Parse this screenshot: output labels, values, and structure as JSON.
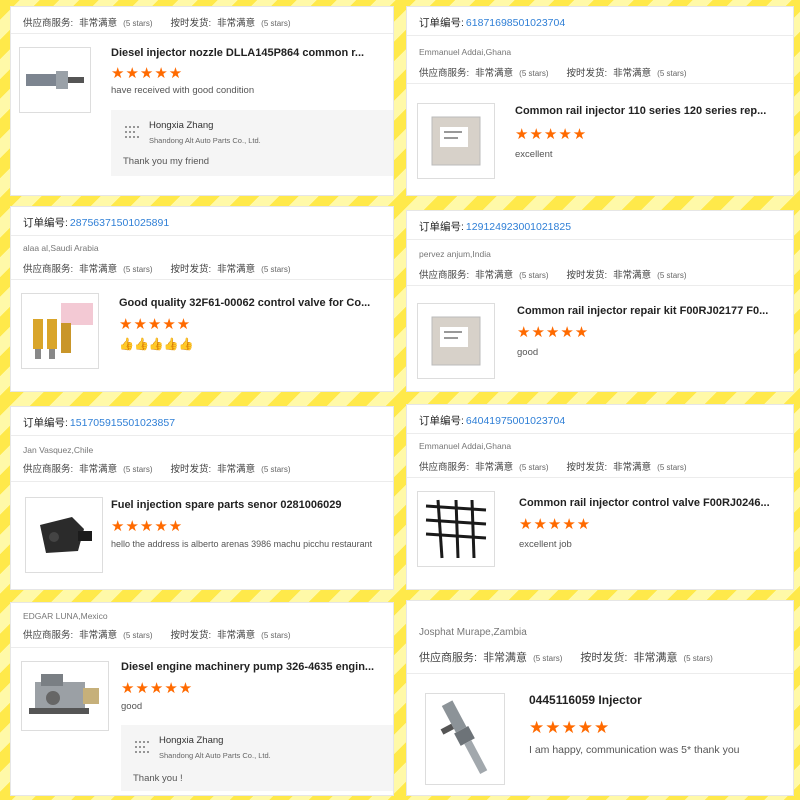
{
  "order_label": "订单编号:",
  "rating_labels": {
    "supplier": "供应商服务:",
    "ontime": "按时发货:",
    "value": "非常满意",
    "stars": "(5 stars)"
  },
  "reviews": [
    {
      "order_no": "",
      "buyer": "",
      "title": "Diesel injector nozzle DLLA145P864 common r...",
      "stars": "★★★★★",
      "comment": "have received with good condition",
      "reply": {
        "name": "Hongxia Zhang",
        "company": "Shandong Alt Auto Parts Co., Ltd.",
        "text": "Thank you my friend"
      }
    },
    {
      "order_no": "61871698501023704",
      "buyer": "Emmanuel Addai,Ghana",
      "title": "Common rail injector 110 series 120 series rep...",
      "stars": "★★★★★",
      "comment": "excellent"
    },
    {
      "order_no": "28756371501025891",
      "buyer": "alaa al,Saudi Arabia",
      "title": "Good quality 32F61-00062 control valve for Co...",
      "stars": "★★★★★",
      "comment": "👍👍👍👍👍"
    },
    {
      "order_no": "129124923001021825",
      "buyer": "pervez anjum,India",
      "title": "Common rail injector repair kit F00RJ02177 F0...",
      "stars": "★★★★★",
      "comment": "good"
    },
    {
      "order_no": "151705915501023857",
      "buyer": "Jan Vasquez,Chile",
      "title": "Fuel injection spare parts senor 0281006029",
      "stars": "★★★★★",
      "comment": "hello the address is alberto arenas 3986 machu picchu restaurant"
    },
    {
      "order_no": "64041975001023704",
      "buyer": "Emmanuel Addai,Ghana",
      "title": "Common rail injector control valve F00RJ0246...",
      "stars": "★★★★★",
      "comment": "excellent job"
    },
    {
      "order_no": "",
      "buyer": "EDGAR LUNA,Mexico",
      "title": "Diesel engine machinery pump 326-4635 engin...",
      "stars": "★★★★★",
      "comment": "good",
      "reply": {
        "name": "Hongxia Zhang",
        "company": "Shandong Alt Auto Parts Co., Ltd.",
        "text": "Thank you !"
      }
    },
    {
      "order_no": "",
      "buyer": "Josphat Murape,Zambia",
      "title": "0445116059 Injector",
      "stars": "★★★★★",
      "comment": "I am happy, communication was 5* thank you"
    }
  ],
  "colors": {
    "accent_star": "#ff6a00",
    "order_link": "#2f7fd6",
    "background": "#ffe94a"
  }
}
